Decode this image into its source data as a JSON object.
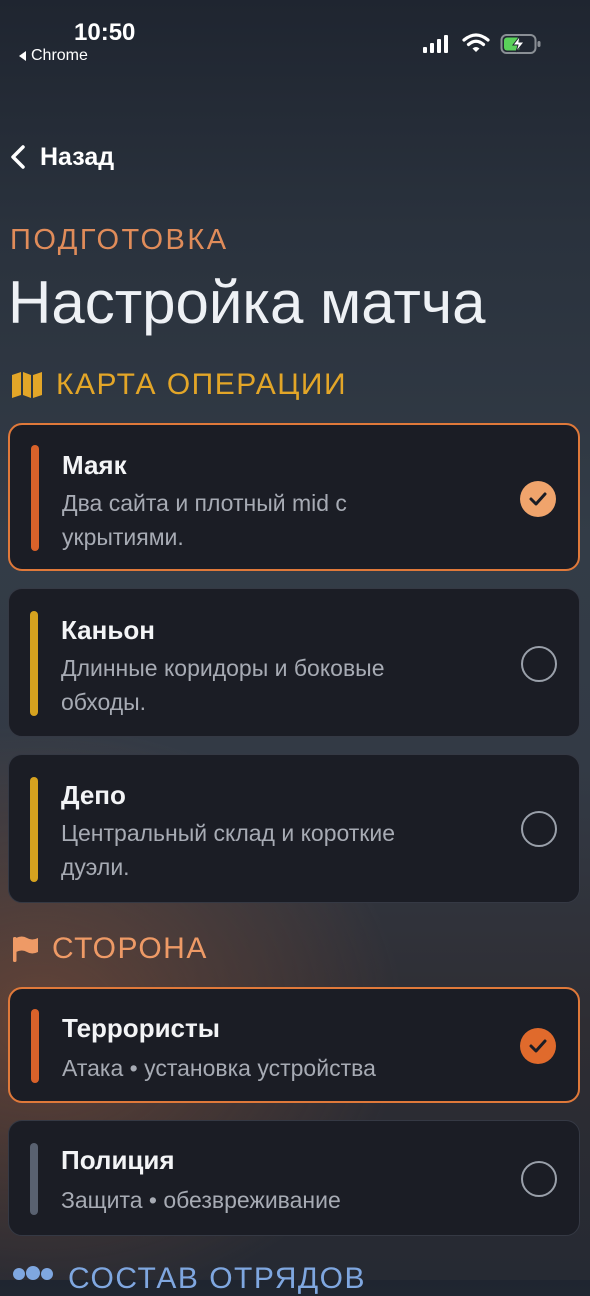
{
  "status_bar": {
    "time": "10:50",
    "back_app": "Chrome"
  },
  "nav": {
    "back_label": "Назад"
  },
  "header": {
    "eyebrow": "ПОДГОТОВКА",
    "title": "Настройка матча"
  },
  "map_section": {
    "heading": "КАРТА ОПЕРАЦИИ",
    "icon": "map-icon",
    "options": [
      {
        "name": "Маяк",
        "desc": "Два сайта и плотный mid с укрытиями.",
        "selected": true,
        "color": "#d9622a"
      },
      {
        "name": "Каньон",
        "desc": "Длинные коридоры и боковые обходы.",
        "selected": false,
        "color": "#d6a21f"
      },
      {
        "name": "Депо",
        "desc": "Центральный склад и короткие дуэли.",
        "selected": false,
        "color": "#d6a21f"
      }
    ]
  },
  "side_section": {
    "heading": "СТОРОНА",
    "icon": "flag-icon",
    "options": [
      {
        "name": "Террористы",
        "desc": "Атака • установка устройства",
        "selected": true,
        "color": "#d9622a"
      },
      {
        "name": "Полиция",
        "desc": "Защита • обезвреживание",
        "selected": false,
        "color": "#596170"
      }
    ]
  },
  "squad_section": {
    "heading": "СОСТАВ ОТРЯДОВ",
    "icon": "people-icon"
  },
  "colors": {
    "accent": "#e0793a",
    "map_heading": "#e3a628",
    "side_heading": "#ee9a66",
    "check_light": "#f0a46c",
    "check_dark": "#e06a2c"
  }
}
